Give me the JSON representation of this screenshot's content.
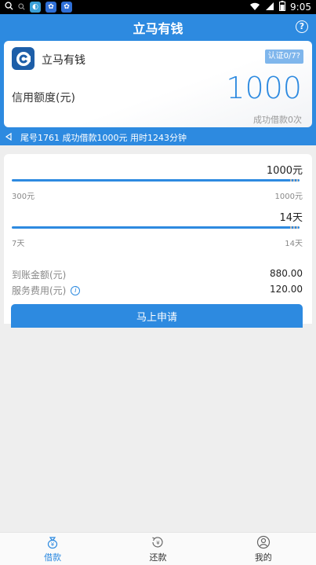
{
  "status_bar": {
    "time": "9:05"
  },
  "app_bar": {
    "title": "立马有钱",
    "help_glyph": "?"
  },
  "card": {
    "app_name": "立马有钱",
    "verify_badge": "认证0/7?",
    "credit_label": "信用额度(元)",
    "credit_amount": "1000",
    "success_count": "成功借款0次"
  },
  "ticker": {
    "message": "尾号1761 成功借款1000元 用时1243分钟"
  },
  "amount_slider": {
    "value_label": "1000元",
    "min_label": "300元",
    "max_label": "1000元",
    "fraction": 1.0
  },
  "term_slider": {
    "value_label": "14天",
    "min_label": "7天",
    "max_label": "14天",
    "fraction": 1.0
  },
  "summary": {
    "received_label": "到账金额(元)",
    "received_value": "880.00",
    "fee_label": "服务费用(元)",
    "fee_value": "120.00"
  },
  "apply_button": {
    "label": "马上申请"
  },
  "tabs": [
    {
      "label": "借款",
      "icon": "money-bag-icon",
      "active": true
    },
    {
      "label": "还款",
      "icon": "repay-icon",
      "active": false
    },
    {
      "label": "我的",
      "icon": "user-icon",
      "active": false
    }
  ],
  "colors": {
    "accent": "#2d8ae0",
    "badge": "#7fb6ec"
  }
}
